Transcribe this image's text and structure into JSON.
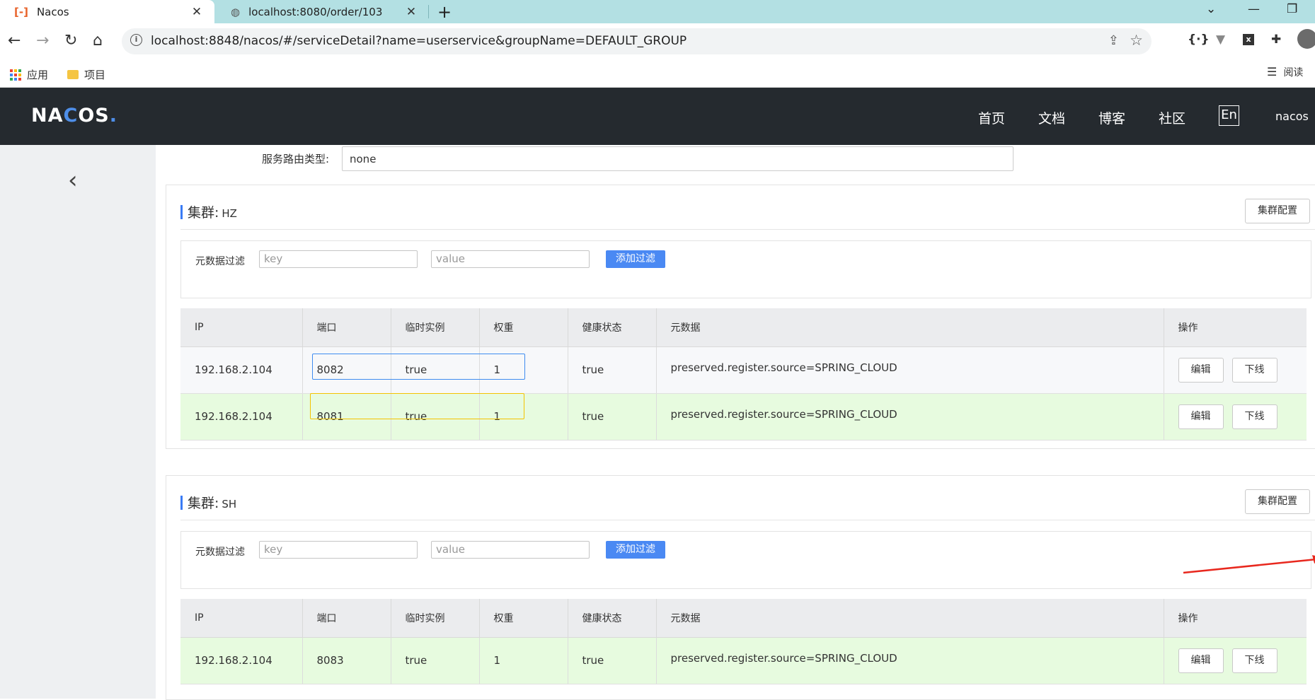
{
  "browser": {
    "tabs": [
      {
        "title": "Nacos",
        "active": true
      },
      {
        "title": "localhost:8080/order/103",
        "active": false
      }
    ],
    "url": "localhost:8848/nacos/#/serviceDetail?name=userservice&groupName=DEFAULT_GROUP",
    "bookmarks": [
      "应用",
      "项目"
    ],
    "reading_list_label": "阅读"
  },
  "header": {
    "logo": {
      "n": "NA",
      "c": "C",
      "os": "OS",
      "dot": "."
    },
    "menu": [
      "首页",
      "文档",
      "博客",
      "社区"
    ],
    "lang": "En",
    "user": "nacos"
  },
  "route": {
    "label": "服务路由类型:",
    "value": "none"
  },
  "clusters": [
    {
      "title_key": "集群:",
      "name": "HZ",
      "config_button": "集群配置",
      "filter": {
        "label": "元数据过滤",
        "key_placeholder": "key",
        "value_placeholder": "value",
        "button": "添加过滤"
      },
      "columns": [
        "IP",
        "端口",
        "临时实例",
        "权重",
        "健康状态",
        "元数据",
        "操作"
      ],
      "rows": [
        {
          "ip": "192.168.2.104",
          "port": "8082",
          "ephemeral": "true",
          "weight": "1",
          "healthy": "true",
          "metadata": "preserved.register.source=SPRING_CLOUD",
          "edit": "编辑",
          "offline": "下线"
        },
        {
          "ip": "192.168.2.104",
          "port": "8081",
          "ephemeral": "true",
          "weight": "1",
          "healthy": "true",
          "metadata": "preserved.register.source=SPRING_CLOUD",
          "edit": "编辑",
          "offline": "下线"
        }
      ]
    },
    {
      "title_key": "集群:",
      "name": "SH",
      "config_button": "集群配置",
      "filter": {
        "label": "元数据过滤",
        "key_placeholder": "key",
        "value_placeholder": "value",
        "button": "添加过滤"
      },
      "columns": [
        "IP",
        "端口",
        "临时实例",
        "权重",
        "健康状态",
        "元数据",
        "操作"
      ],
      "rows": [
        {
          "ip": "192.168.2.104",
          "port": "8083",
          "ephemeral": "true",
          "weight": "1",
          "healthy": "true",
          "metadata": "preserved.register.source=SPRING_CLOUD",
          "edit": "编辑",
          "offline": "下线"
        }
      ]
    }
  ],
  "colors": {
    "accent": "#4a89f3",
    "header_bg": "#252a2f",
    "row_green": "#e7fbdf",
    "annotation_arrow": "#e8281e",
    "highlight_blue": "#3f8cf0",
    "highlight_yellow": "#f4c300"
  }
}
